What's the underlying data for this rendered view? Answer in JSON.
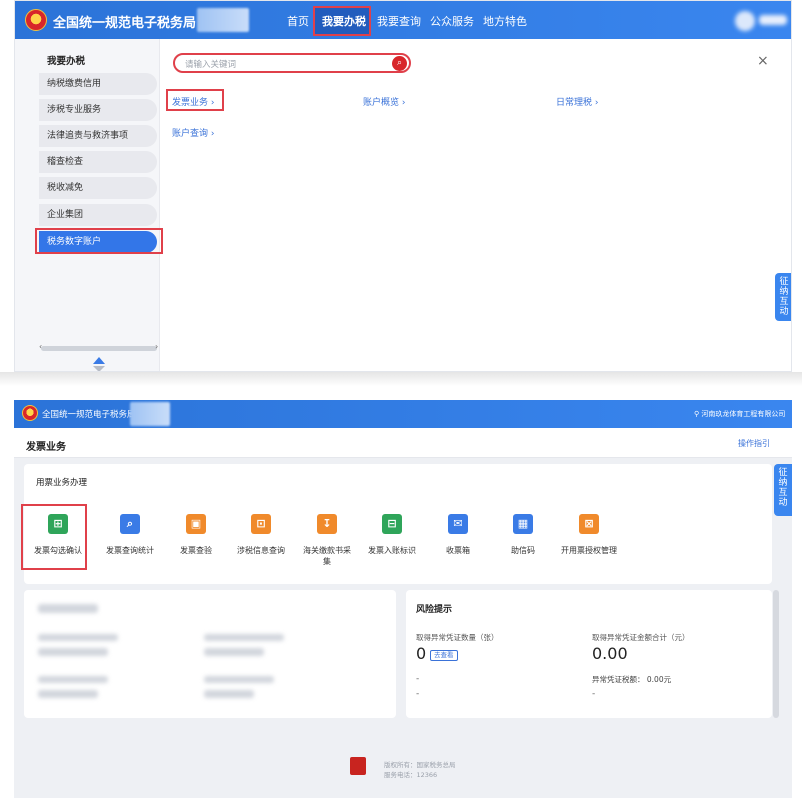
{
  "panel1": {
    "site_title": "全国统一规范电子税务局",
    "nav": [
      "首页",
      "我要办税",
      "我要查询",
      "公众服务",
      "地方特色"
    ],
    "sidebar": {
      "title": "我要办税",
      "items": [
        "纳税缴费信用",
        "涉税专业服务",
        "法律追责与救济事项",
        "稽查检查",
        "税收减免",
        "企业集团",
        "税务数字账户"
      ],
      "active_index": 6
    },
    "search": {
      "placeholder": "请输入关键词",
      "search_icon": "search-icon"
    },
    "close_label": "×",
    "categories": [
      "发票业务 ›",
      "账户概览 ›",
      "日常理税 ›",
      "账户查询 ›"
    ],
    "float_tab": [
      "征",
      "纳",
      "互",
      "动"
    ],
    "colors": {
      "brand_blue": "#2b73d8",
      "highlight_red": "#e0404a",
      "active_blue": "#3376e8"
    }
  },
  "panel2": {
    "site_title": "全国统一规范电子税务局",
    "company": "河南玖龙体育工程有限公司",
    "page_title": "发票业务",
    "guide": "操作指引",
    "section_title": "用票业务办理",
    "tiles": [
      {
        "label": "发票勾选确认",
        "icon": "invoice-check-icon",
        "color": "#2fa55a"
      },
      {
        "label": "发票查询统计",
        "icon": "invoice-search-icon",
        "color": "#3a7be6"
      },
      {
        "label": "发票查验",
        "icon": "invoice-verify-icon",
        "color": "#f08a2b"
      },
      {
        "label": "涉税信息查询",
        "icon": "tax-info-icon",
        "color": "#f08a2b"
      },
      {
        "label": "海关缴款书采集",
        "icon": "customs-icon",
        "color": "#f08a2b"
      },
      {
        "label": "发票入账标识",
        "icon": "bookkeeping-icon",
        "color": "#2fa55a"
      },
      {
        "label": "收票箱",
        "icon": "inbox-icon",
        "color": "#3a7be6"
      },
      {
        "label": "助信码",
        "icon": "qrcode-icon",
        "color": "#3a7be6"
      },
      {
        "label": "开用票授权管理",
        "icon": "auth-icon",
        "color": "#f08a2b"
      }
    ],
    "risk": {
      "title": "风险提示",
      "count_label": "取得异常凭证数量（张）",
      "count_value": "0",
      "view_label": "去查看",
      "amount_label": "取得异常凭证金额合计（元）",
      "amount_value": "0.00",
      "tax_label": "异常凭证税额：",
      "tax_value": "0.00元",
      "dash": "-"
    },
    "footer": {
      "owner": "版权所有：国家税务总局",
      "phone": "服务电话：12366"
    },
    "float_tab": [
      "征",
      "纳",
      "互",
      "动"
    ]
  }
}
